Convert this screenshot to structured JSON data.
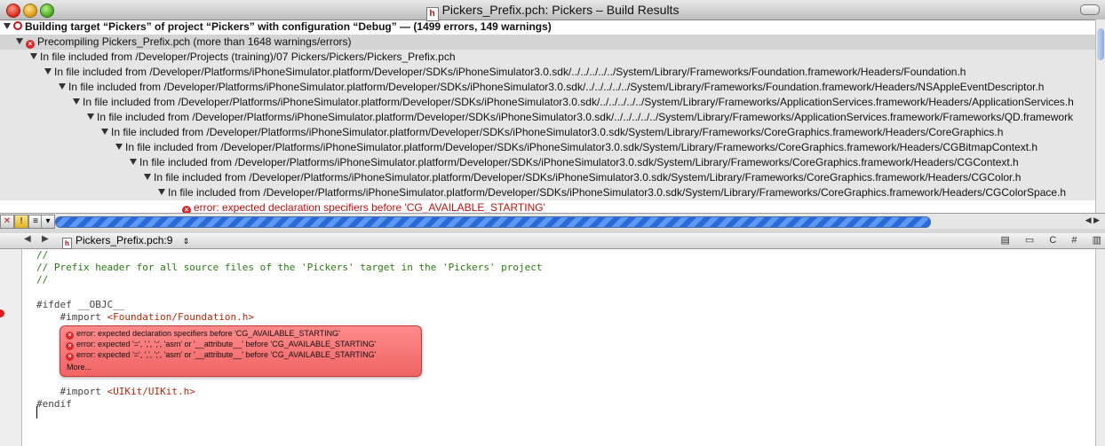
{
  "window": {
    "title": "Pickers_Prefix.pch: Pickers – Build Results",
    "doc_icon": "h"
  },
  "results": {
    "rows": [
      {
        "text": "Building target “Pickers” of project “Pickers” with configuration “Debug” — (1499 errors, 149 warnings)",
        "indent": 4
      },
      {
        "text": "Precompiling Pickers_Prefix.pch (more than 1648 warnings/errors)",
        "indent": 18
      },
      {
        "text": "In file included from /Developer/Projects (training)/07 Pickers/Pickers/Pickers_Prefix.pch",
        "indent": 34
      },
      {
        "text": "In file included from /Developer/Platforms/iPhoneSimulator.platform/Developer/SDKs/iPhoneSimulator3.0.sdk/../../../../../System/Library/Frameworks/Foundation.framework/Headers/Foundation.h",
        "indent": 50
      },
      {
        "text": "In file included from /Developer/Platforms/iPhoneSimulator.platform/Developer/SDKs/iPhoneSimulator3.0.sdk/../../../../../System/Library/Frameworks/Foundation.framework/Headers/NSAppleEventDescriptor.h",
        "indent": 66
      },
      {
        "text": "In file included from /Developer/Platforms/iPhoneSimulator.platform/Developer/SDKs/iPhoneSimulator3.0.sdk/../../../../../System/Library/Frameworks/ApplicationServices.framework/Headers/ApplicationServices.h",
        "indent": 82
      },
      {
        "text": "In file included from /Developer/Platforms/iPhoneSimulator.platform/Developer/SDKs/iPhoneSimulator3.0.sdk/../../../../../System/Library/Frameworks/ApplicationServices.framework/Frameworks/QD.framework",
        "indent": 98
      },
      {
        "text": "In file included from /Developer/Platforms/iPhoneSimulator.platform/Developer/SDKs/iPhoneSimulator3.0.sdk/System/Library/Frameworks/CoreGraphics.framework/Headers/CoreGraphics.h",
        "indent": 114
      },
      {
        "text": "In file included from /Developer/Platforms/iPhoneSimulator.platform/Developer/SDKs/iPhoneSimulator3.0.sdk/System/Library/Frameworks/CoreGraphics.framework/Headers/CGBitmapContext.h",
        "indent": 130
      },
      {
        "text": "In file included from /Developer/Platforms/iPhoneSimulator.platform/Developer/SDKs/iPhoneSimulator3.0.sdk/System/Library/Frameworks/CoreGraphics.framework/Headers/CGContext.h",
        "indent": 146
      },
      {
        "text": "In file included from /Developer/Platforms/iPhoneSimulator.platform/Developer/SDKs/iPhoneSimulator3.0.sdk/System/Library/Frameworks/CoreGraphics.framework/Headers/CGColor.h",
        "indent": 162
      },
      {
        "text": "In file included from /Developer/Platforms/iPhoneSimulator.platform/Developer/SDKs/iPhoneSimulator3.0.sdk/System/Library/Frameworks/CoreGraphics.framework/Headers/CGColorSpace.h",
        "indent": 178
      },
      {
        "text": "error: expected declaration specifiers before 'CG_AVAILABLE_STARTING'",
        "indent": 205
      }
    ]
  },
  "progress": {
    "fraction": 1.0
  },
  "navbar": {
    "file_label": "Pickers_Prefix.pch:9",
    "right_items": [
      "C",
      "#"
    ]
  },
  "editor": {
    "lines": [
      {
        "text": "//",
        "cls": "comment"
      },
      {
        "text": "// Prefix header for all source files of the 'Pickers' target in the 'Pickers' project",
        "cls": "comment"
      },
      {
        "text": "//",
        "cls": "comment"
      },
      {
        "text": "",
        "cls": ""
      },
      {
        "text": "#ifdef __OBJC__",
        "cls": "directive"
      },
      {
        "text": "    #import ",
        "cls": "directive",
        "incl": "<Foundation/Foundation.h>"
      },
      {
        "text": "",
        "cls": ""
      },
      {
        "text": "",
        "cls": ""
      },
      {
        "text": "",
        "cls": ""
      },
      {
        "text": "",
        "cls": ""
      },
      {
        "text": "",
        "cls": ""
      },
      {
        "text": "    #import ",
        "cls": "directive",
        "incl": "<UIKit/UIKit.h>"
      },
      {
        "text": "#endif",
        "cls": "directive"
      }
    ],
    "error_bubble": {
      "errors": [
        "error: expected declaration specifiers before 'CG_AVAILABLE_STARTING'",
        "error: expected '=', ',', ';', 'asm' or '__attribute__' before 'CG_AVAILABLE_STARTING'",
        "error: expected '=', ',', ';', 'asm' or '__attribute__' before 'CG_AVAILABLE_STARTING'"
      ],
      "more_label": "More..."
    }
  },
  "colors": {
    "error_red": "#c01010",
    "bubble_red": "#f06464",
    "progress_blue": "#2a6ad8"
  }
}
